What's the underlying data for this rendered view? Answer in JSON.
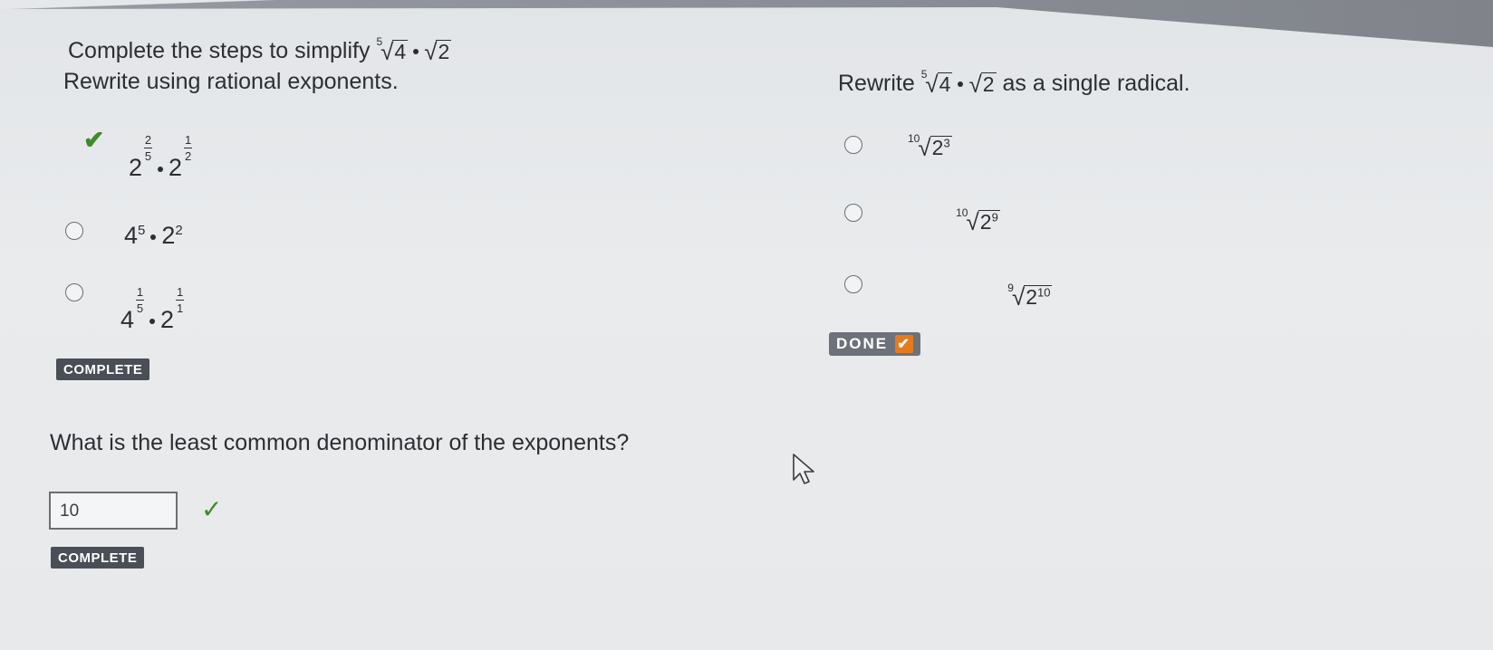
{
  "left": {
    "prompt": "Complete the steps to simplify",
    "step1": {
      "instruction": "Rewrite using rational exponents.",
      "options": [
        {
          "base1": "2",
          "num1": "2",
          "den1": "5",
          "base2": "2",
          "num2": "1",
          "den2": "2",
          "checked": true
        },
        {
          "base1": "4",
          "exp1": "5",
          "base2": "2",
          "exp2": "2"
        },
        {
          "base1": "4",
          "num1": "1",
          "den1": "5",
          "base2": "2",
          "num2": "1",
          "den2": "1"
        }
      ],
      "badge": "COMPLETE"
    },
    "step2": {
      "question": "What is the least common denominator of the exponents?",
      "answer": "10",
      "badge": "COMPLETE"
    }
  },
  "right": {
    "prompt_before": "Rewrite",
    "prompt_after": "as a single radical.",
    "options": [
      {
        "index": "10",
        "base": "2",
        "exp": "3"
      },
      {
        "index": "10",
        "base": "2",
        "exp": "9"
      },
      {
        "index": "9",
        "base": "2",
        "exp": "10"
      }
    ],
    "done_label": "DONE"
  },
  "expression": {
    "root_index": "5",
    "radicand1": "4",
    "radicand2": "2"
  },
  "icons": {
    "check": "checkmark-icon",
    "cursor": "mouse-pointer-icon"
  },
  "colors": {
    "check": "#3f8a2a",
    "badge": "#4a4e56",
    "done_check": "#e67b1e"
  }
}
